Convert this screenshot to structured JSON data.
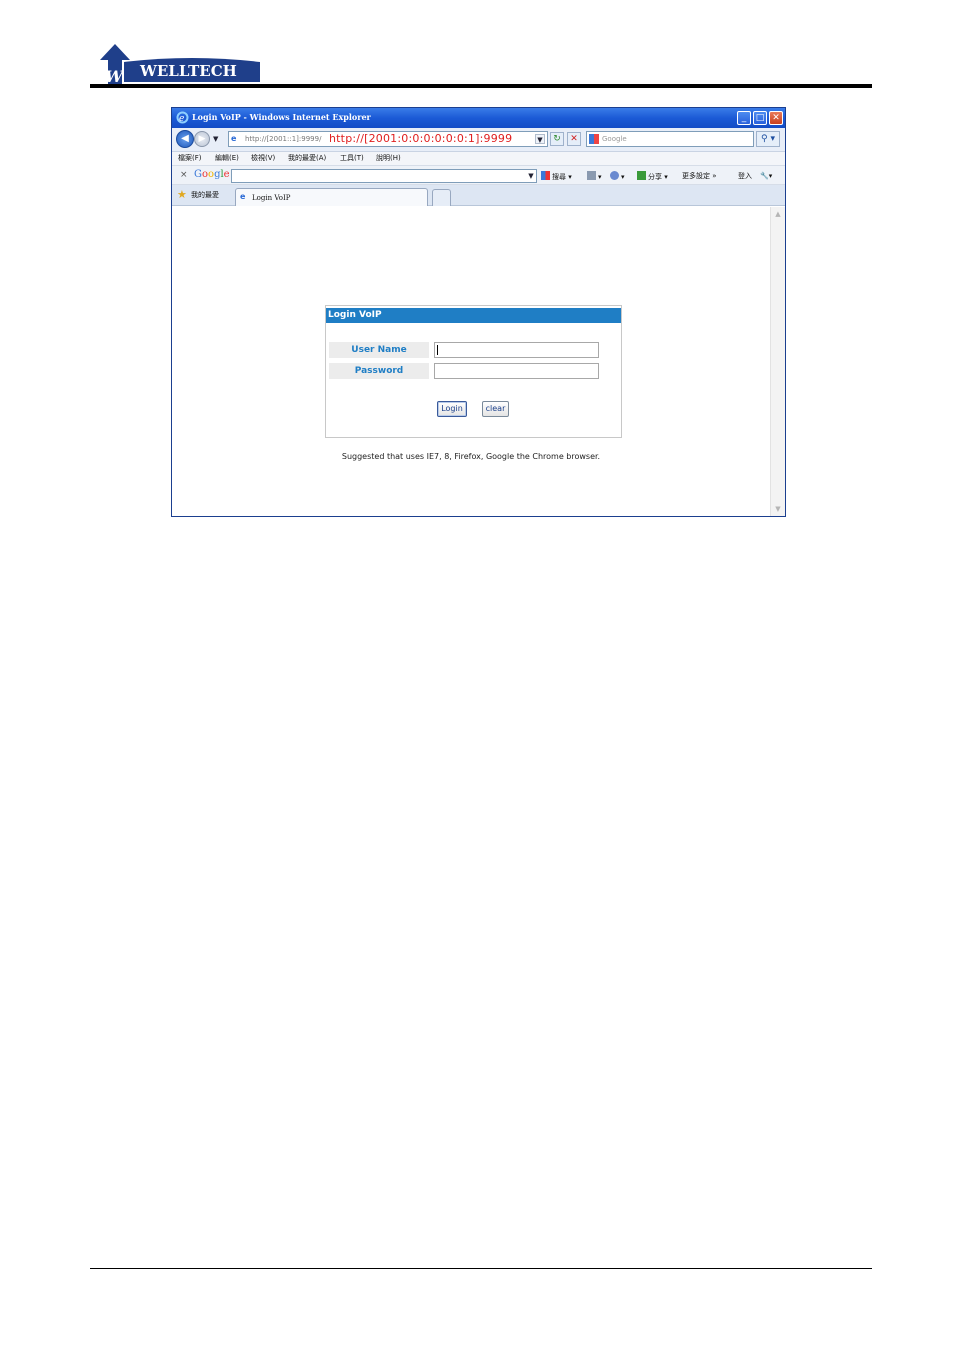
{
  "document": {
    "logo_text": "WELLTECH"
  },
  "browser": {
    "window_title": "Login VoIP - Windows Internet Explorer",
    "window_buttons": {
      "minimize": "_",
      "maximize": "□",
      "close": "✕"
    },
    "address": {
      "url_text": "http://[2001::1]:9999/",
      "overlay_text": "http://[2001:0:0:0:0:0:0:1]:9999"
    },
    "search": {
      "placeholder": "Google"
    },
    "menu": [
      "檔案(F)",
      "編輯(E)",
      "檢視(V)",
      "我的最愛(A)",
      "工具(T)",
      "說明(H)"
    ],
    "google_toolbar": {
      "close": "×",
      "logo": "Google",
      "search_label": "搜尋",
      "share_label": "分享",
      "more_label": "更多設定 »",
      "signin_label": "登入"
    },
    "favorites_label": "我的最愛",
    "tabs": [
      {
        "label": "Login VoIP"
      }
    ]
  },
  "login": {
    "title": "Login VoIP",
    "username_label": "User Name",
    "username_value": "",
    "password_label": "Password",
    "password_value": "",
    "login_button": "Login",
    "clear_button": "clear",
    "suggestion": "Suggested that uses IE7, 8, Firefox, Google the Chrome browser."
  },
  "colors": {
    "login_header": "#1f7ec5",
    "label_text": "#1f7ec5",
    "url_overlay": "#e02020",
    "titlebar": "#1b5ad6"
  }
}
